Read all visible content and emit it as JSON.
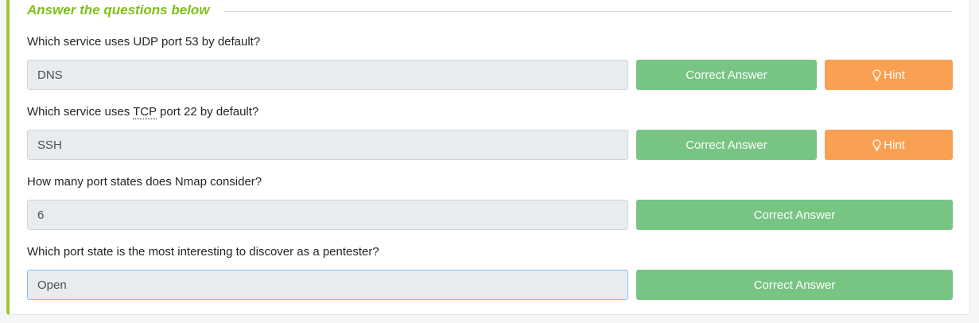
{
  "section": {
    "title": "Answer the questions below"
  },
  "questions": [
    {
      "text_pre": "Which service uses UDP port 53 by default?",
      "abbr": "",
      "text_post": "",
      "answer": "DNS",
      "button": "Correct Answer",
      "hint": "Hint"
    },
    {
      "text_pre": "Which service uses ",
      "abbr": "TCP",
      "text_post": " port 22 by default?",
      "answer": "SSH",
      "button": "Correct Answer",
      "hint": "Hint"
    },
    {
      "text_pre": "How many port states does Nmap consider?",
      "abbr": "",
      "text_post": "",
      "answer": "6",
      "button": "Correct Answer"
    },
    {
      "text_pre": "Which port state is the most interesting to discover as a pentester?",
      "abbr": "",
      "text_post": "",
      "answer": "Open",
      "button": "Correct Answer"
    }
  ],
  "colors": {
    "accent": "#7fbf19",
    "correct": "#77c483",
    "hint": "#f9a052",
    "border_left": "#a4c434"
  },
  "icons": {
    "hint": "lightbulb-icon"
  }
}
